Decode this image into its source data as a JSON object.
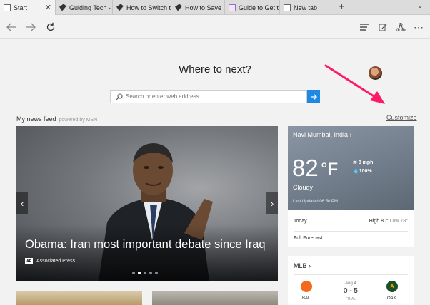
{
  "tabs": [
    {
      "title": "Start",
      "active": true,
      "icon": "start-page-icon"
    },
    {
      "title": "Guiding Tech - L",
      "icon": "guiding-tech-icon"
    },
    {
      "title": "How to Switch tl",
      "icon": "guiding-tech-icon"
    },
    {
      "title": "How to Save Spa",
      "icon": "guiding-tech-icon"
    },
    {
      "title": "Guide to Get the",
      "icon": "guide-icon"
    },
    {
      "title": "New tab",
      "icon": "new-tab-icon"
    }
  ],
  "toolbar": {
    "icons": [
      "back-arrow-icon",
      "forward-arrow-icon",
      "refresh-icon",
      "hub-icon",
      "web-note-icon",
      "share-icon",
      "more-icon"
    ]
  },
  "start": {
    "heading": "Where to next?",
    "search_placeholder": "Search or enter web address"
  },
  "feed": {
    "label": "My news feed",
    "powered_by": "powered by MSN",
    "customize": "Customize"
  },
  "hero": {
    "title": "Obama: Iran most important debate since Iraq",
    "source": "Associated Press",
    "source_logo": "AP",
    "slide_count": 5,
    "active_slide": 1
  },
  "weather": {
    "location": "Navi Mumbai, India",
    "temperature": "82",
    "unit": "°F",
    "wind": "8 mph",
    "humidity": "100%",
    "condition": "Cloudy",
    "last_updated": "Last Updated 06:50 PM",
    "today_label": "Today",
    "high": "High 80°",
    "low": "Low 78°",
    "full_forecast": "Full Forecast"
  },
  "mlb": {
    "title": "MLB",
    "date": "Aug 4",
    "score": "0 - 5",
    "status": "FINAL",
    "home": "BAL",
    "away": "OAK"
  },
  "colors": {
    "accent": "#1e88e5",
    "annotation_arrow": "#ff1a66"
  }
}
